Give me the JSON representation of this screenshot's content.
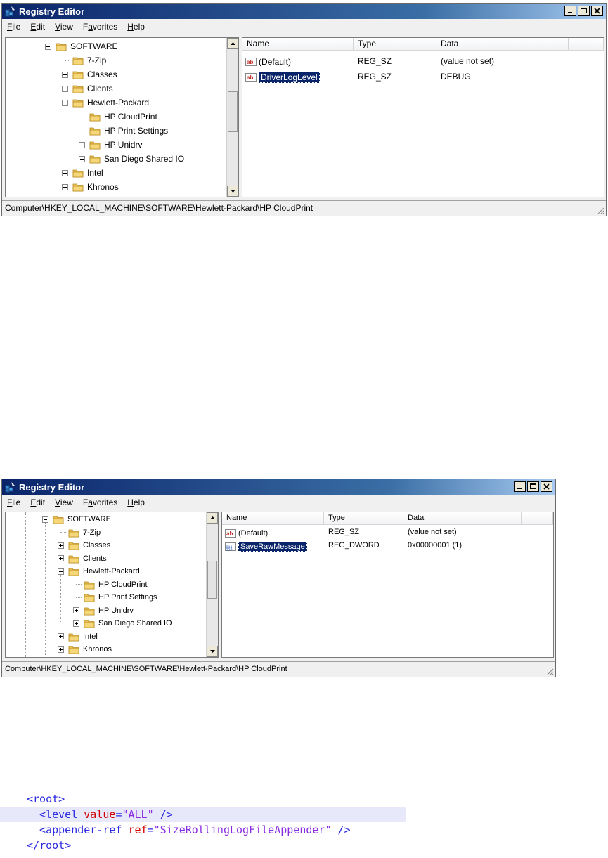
{
  "window1": {
    "title": "Registry Editor",
    "menu": [
      {
        "label": "File",
        "underline": "F",
        "rest": "ile"
      },
      {
        "label": "Edit",
        "underline": "E",
        "rest": "dit"
      },
      {
        "label": "View",
        "underline": "V",
        "rest": "iew"
      },
      {
        "label": "Favorites",
        "underline": "a",
        "pre": "F",
        "rest": "vorites"
      },
      {
        "label": "Help",
        "underline": "H",
        "rest": "elp"
      }
    ],
    "tree": {
      "items": [
        {
          "label": "SOFTWARE",
          "expander": "minus"
        },
        {
          "label": "7-Zip",
          "expander": "none"
        },
        {
          "label": "Classes",
          "expander": "plus"
        },
        {
          "label": "Clients",
          "expander": "plus"
        },
        {
          "label": "Hewlett-Packard",
          "expander": "minus"
        },
        {
          "label": "HP CloudPrint",
          "expander": "none"
        },
        {
          "label": "HP Print Settings",
          "expander": "none"
        },
        {
          "label": "HP Unidrv",
          "expander": "plus"
        },
        {
          "label": "San Diego Shared IO",
          "expander": "plus"
        },
        {
          "label": "Intel",
          "expander": "plus"
        },
        {
          "label": "Khronos",
          "expander": "plus"
        }
      ]
    },
    "columns": [
      "Name",
      "Type",
      "Data"
    ],
    "values": [
      {
        "name": "(Default)",
        "type": "REG_SZ",
        "data": "(value not set)",
        "icon": "string-value-icon",
        "selected": false
      },
      {
        "name": "DriverLogLevel",
        "type": "REG_SZ",
        "data": "DEBUG",
        "icon": "string-value-icon",
        "selected": true
      }
    ],
    "status": "Computer\\HKEY_LOCAL_MACHINE\\SOFTWARE\\Hewlett-Packard\\HP CloudPrint"
  },
  "window2": {
    "title": "Registry Editor",
    "menu": [
      {
        "label": "File"
      },
      {
        "label": "Edit"
      },
      {
        "label": "View"
      },
      {
        "label": "Favorites"
      },
      {
        "label": "Help"
      }
    ],
    "tree": {
      "items": [
        {
          "label": "SOFTWARE",
          "expander": "minus"
        },
        {
          "label": "7-Zip",
          "expander": "none"
        },
        {
          "label": "Classes",
          "expander": "plus"
        },
        {
          "label": "Clients",
          "expander": "plus"
        },
        {
          "label": "Hewlett-Packard",
          "expander": "minus"
        },
        {
          "label": "HP CloudPrint",
          "expander": "none"
        },
        {
          "label": "HP Print Settings",
          "expander": "none"
        },
        {
          "label": "HP Unidrv",
          "expander": "plus"
        },
        {
          "label": "San Diego Shared IO",
          "expander": "plus"
        },
        {
          "label": "Intel",
          "expander": "plus"
        },
        {
          "label": "Khronos",
          "expander": "plus"
        }
      ]
    },
    "columns": [
      "Name",
      "Type",
      "Data"
    ],
    "values": [
      {
        "name": "(Default)",
        "type": "REG_SZ",
        "data": "(value not set)",
        "icon": "string-value-icon",
        "selected": false
      },
      {
        "name": "SaveRawMessage",
        "type": "REG_DWORD",
        "data": "0x00000001 (1)",
        "icon": "dword-value-icon",
        "selected": true
      }
    ],
    "status": "Computer\\HKEY_LOCAL_MACHINE\\SOFTWARE\\Hewlett-Packard\\HP CloudPrint"
  },
  "code": {
    "lines": [
      {
        "parts": [
          [
            "punct",
            "<"
          ],
          [
            "tag",
            "root"
          ],
          [
            "punct",
            ">"
          ]
        ]
      },
      {
        "parts": [
          [
            "punct",
            "  <"
          ],
          [
            "tag",
            "level"
          ],
          [
            "plain",
            " "
          ],
          [
            "attr",
            "value"
          ],
          [
            "punct",
            "="
          ],
          [
            "str",
            "\"ALL\""
          ],
          [
            "punct",
            " />"
          ]
        ],
        "highlighted": true
      },
      {
        "parts": [
          [
            "punct",
            "  <"
          ],
          [
            "tag",
            "appender-ref"
          ],
          [
            "plain",
            " "
          ],
          [
            "attr",
            "ref"
          ],
          [
            "punct",
            "="
          ],
          [
            "str",
            "\"SizeRollingLogFileAppender\""
          ],
          [
            "punct",
            " />"
          ]
        ]
      },
      {
        "parts": [
          [
            "punct",
            "</"
          ],
          [
            "tag",
            "root"
          ],
          [
            "punct",
            ">"
          ]
        ]
      }
    ],
    "colors": {
      "tag": "#2a2ae0",
      "attr": "#d10000",
      "string": "#8a2be2",
      "highlight": "#e8e8fb"
    }
  }
}
